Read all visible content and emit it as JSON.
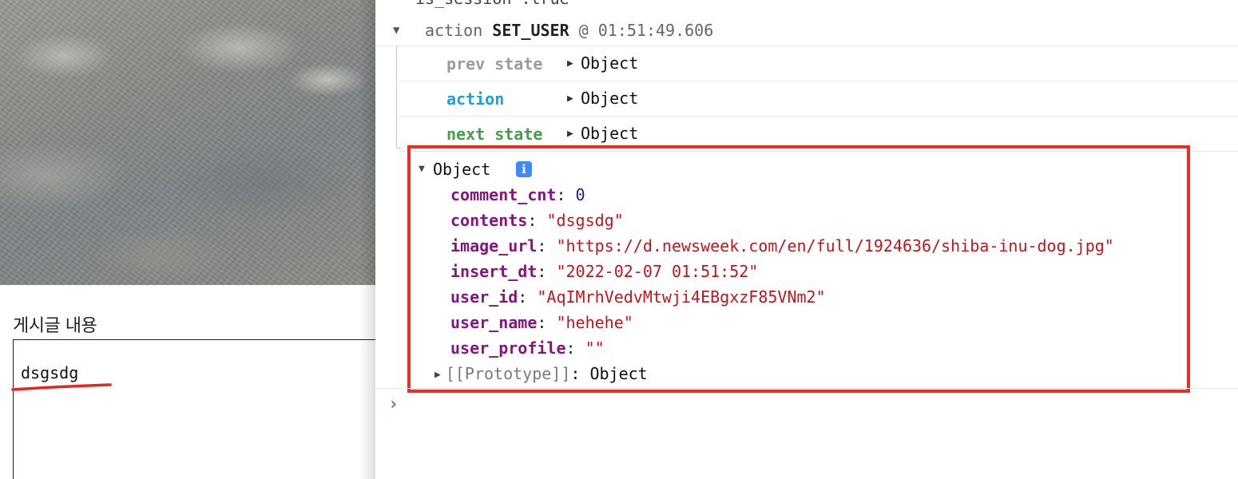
{
  "left_pane": {
    "content_label": "게시글 내용",
    "content_value": "dsgsdg"
  },
  "console": {
    "cut_line": "is_session :true",
    "action_line": {
      "prefix": "action",
      "type": "SET_USER",
      "time": "@ 01:51:49.606"
    },
    "state_rows": [
      {
        "key": "prev state",
        "value": "Object"
      },
      {
        "key": "action",
        "value": "Object"
      },
      {
        "key": "next state",
        "value": "Object"
      }
    ],
    "object": {
      "title": "Object",
      "info_badge": "i",
      "properties": [
        {
          "key": "comment_cnt",
          "value": "0",
          "kind": "number"
        },
        {
          "key": "contents",
          "value": "\"dsgsdg\"",
          "kind": "string"
        },
        {
          "key": "image_url",
          "value": "\"https://d.newsweek.com/en/full/1924636/shiba-inu-dog.jpg\"",
          "kind": "string"
        },
        {
          "key": "insert_dt",
          "value": "\"2022-02-07 01:51:52\"",
          "kind": "string"
        },
        {
          "key": "user_id",
          "value": "\"AqIMrhVedvMtwji4EBgxzF85VNm2\"",
          "kind": "string"
        },
        {
          "key": "user_name",
          "value": "\"hehehe\"",
          "kind": "string"
        },
        {
          "key": "user_profile",
          "value": "\"\"",
          "kind": "string"
        }
      ],
      "prototype": {
        "name": "[[Prototype]]",
        "value": "Object"
      }
    },
    "prompt_symbol": "›"
  },
  "colors": {
    "highlight_border": "#ee2d24",
    "prev_state": "#9b9b9b",
    "action": "#19a0e6",
    "next_state": "#43a047",
    "property_key": "#86167f",
    "string_value": "#c4151c",
    "number_value": "#1a1aa6",
    "prompt": "#3d7ef5"
  }
}
